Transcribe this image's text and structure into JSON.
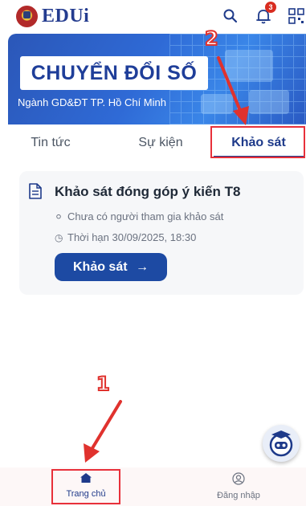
{
  "header": {
    "brand": "EDUi",
    "notification_count": "3",
    "icons": [
      "app-logo",
      "search-icon",
      "bell-icon",
      "qr-code-icon"
    ]
  },
  "banner": {
    "title": "CHUYỂN ĐỔI SỐ",
    "subtitle": "Ngành GD&ĐT TP. Hồ Chí Minh"
  },
  "tabs": [
    {
      "label": "Tin tức",
      "active": false
    },
    {
      "label": "Sự kiện",
      "active": false
    },
    {
      "label": "Khảo sát",
      "active": true
    }
  ],
  "survey_card": {
    "title": "Khảo sát đóng góp ý kiến T8",
    "participants": "Chưa có người tham gia khảo sát",
    "deadline": "Thời hạn 30/09/2025, 18:30",
    "button_label": "Khảo sát",
    "button_arrow": "→"
  },
  "bottom_nav": [
    {
      "label": "Trang chủ",
      "icon": "home-icon",
      "active": true
    },
    {
      "label": "Đăng nhập",
      "icon": "user-circle-icon",
      "active": false
    }
  ],
  "annotations": {
    "step1": "1",
    "step2": "2",
    "color": "#e0322e"
  },
  "colors": {
    "primary": "#1e3a8a",
    "button": "#1d4aa3",
    "highlight": "#e8303a",
    "badge": "#d92d20"
  }
}
